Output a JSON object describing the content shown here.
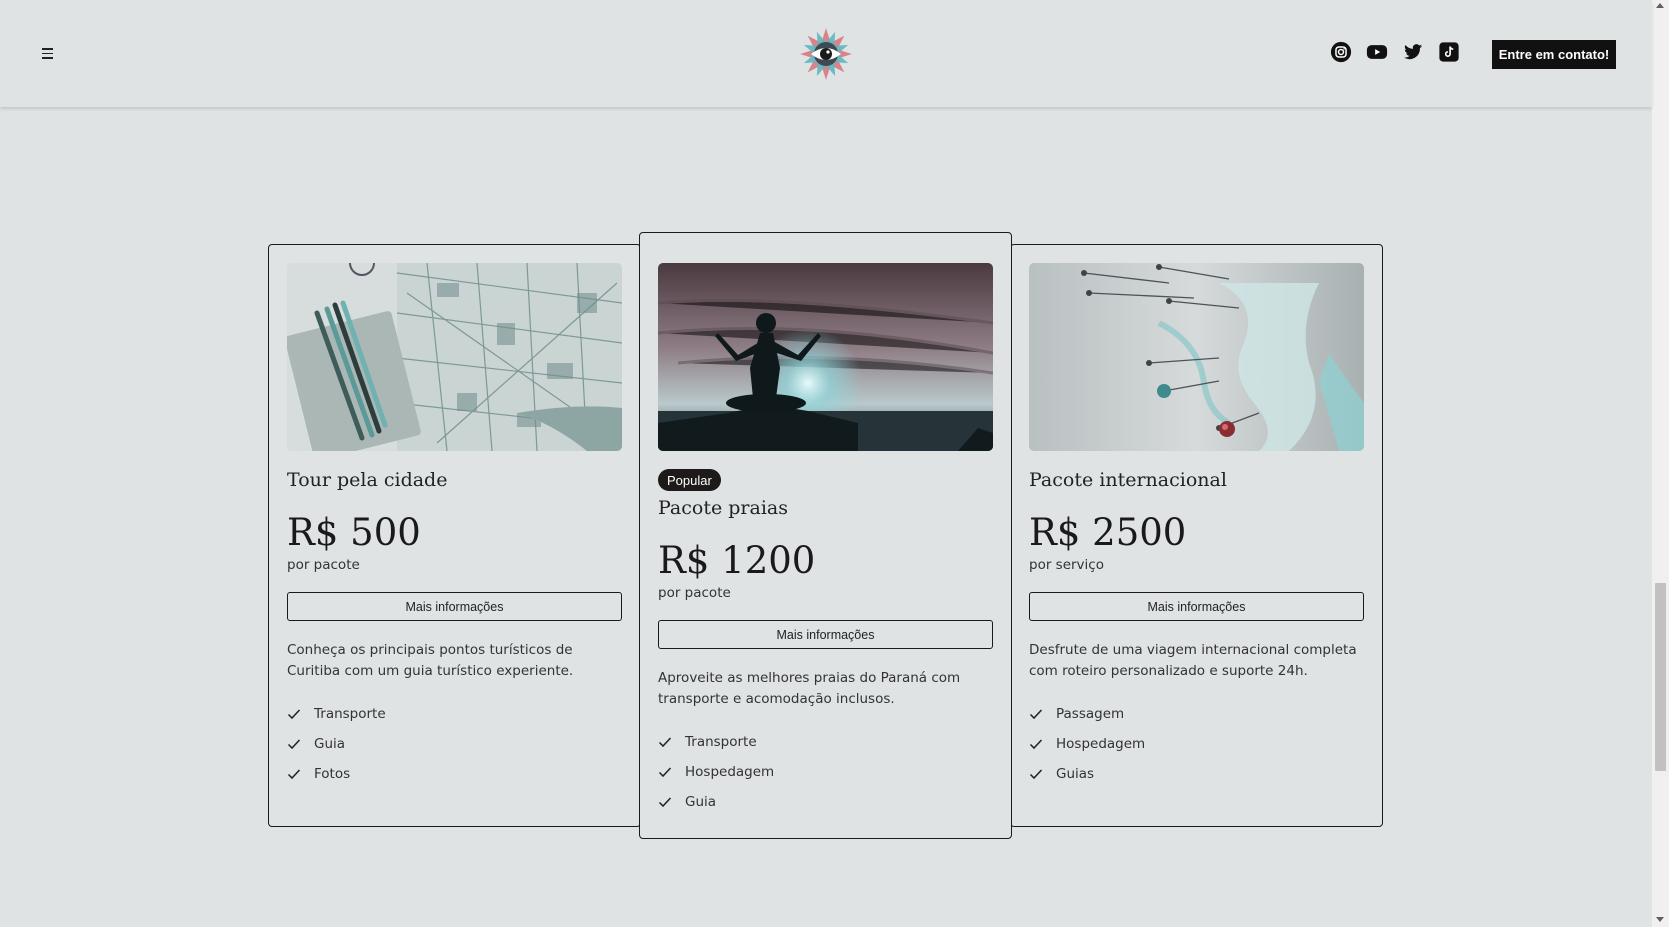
{
  "header": {
    "menu_icon": "hamburger-menu-icon",
    "logo": "eye-flower-logo",
    "socials": [
      "instagram-icon",
      "youtube-icon",
      "twitter-icon",
      "tiktok-icon"
    ],
    "contact_label": "Entre em contato!"
  },
  "cards": [
    {
      "image": "city-map-image",
      "title": "Tour pela cidade",
      "price": "R$ 500",
      "unit": "por pacote",
      "button": "Mais informações",
      "description": "Conheça os principais pontos turísticos de Curitiba com um guia turístico experiente.",
      "features": [
        "Transporte",
        "Guia",
        "Fotos"
      ]
    },
    {
      "image": "yoga-beach-image",
      "badge": "Popular",
      "title": "Pacote praias",
      "price": "R$ 1200",
      "unit": "por pacote",
      "button": "Mais informações",
      "description": "Aproveite as melhores praias do Paraná com transporte e acomodação inclusos.",
      "features": [
        "Transporte",
        "Hospedagem",
        "Guia"
      ]
    },
    {
      "image": "world-map-pins-image",
      "title": "Pacote internacional",
      "price": "R$ 2500",
      "unit": "por serviço",
      "button": "Mais informações",
      "description": "Desfrute de uma viagem internacional completa com roteiro personalizado e suporte 24h.",
      "features": [
        "Passagem",
        "Hospedagem",
        "Guias"
      ]
    }
  ],
  "colors": {
    "background": "#dfe3e4",
    "primary": "#111111",
    "badge": "#1f1a1a"
  }
}
